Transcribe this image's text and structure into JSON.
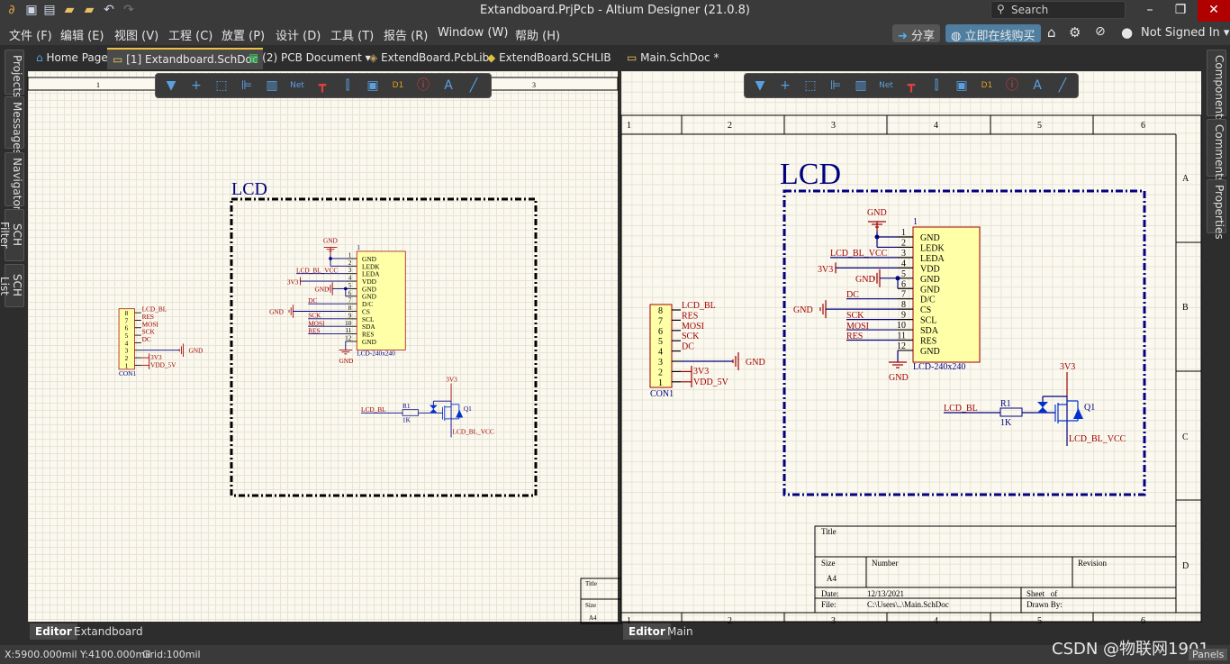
{
  "window": {
    "title": "Extandboard.PrjPcb - Altium Designer (21.0.8)",
    "search_placeholder": "Search",
    "min": "–",
    "restore": "❐",
    "close": "✕"
  },
  "menu": [
    "文件 (F)",
    "编辑 (E)",
    "视图 (V)",
    "工程 (C)",
    "放置 (P)",
    "设计 (D)",
    "工具 (T)",
    "报告 (R)",
    "Window (W)",
    "帮助 (H)"
  ],
  "right_menu": {
    "share": "分享",
    "buy": "立即在线购买",
    "user": "Not Signed In"
  },
  "tabs": [
    {
      "label": "Home Page"
    },
    {
      "label": "[1] Extandboard.SchDoc",
      "active": true
    },
    {
      "label": "(2) PCB Document"
    },
    {
      "label": "ExtendBoard.PcbLib"
    },
    {
      "label": "ExtendBoard.SCHLIB"
    },
    {
      "label": "Main.SchDoc *"
    }
  ],
  "left_panels": [
    "Projects",
    "Messages",
    "Navigator",
    "SCH Filter",
    "SCH List"
  ],
  "right_panels": [
    "Components",
    "Comments",
    "Properties"
  ],
  "toolbar_icons": [
    "filter-icon",
    "crosshair-icon",
    "select-rect-icon",
    "align-icon",
    "part-icon",
    "net-label-icon",
    "power-port-icon",
    "bus-icon",
    "sheet-symbol-icon",
    "port-icon",
    "directive-icon",
    "text-icon",
    "line-icon"
  ],
  "toolbar_text": {
    "net": "Net",
    "vcc": "Vcc",
    "d1": "D1"
  },
  "left_doc": {
    "ruler": [
      "1",
      "3"
    ],
    "title_block": {
      "title": "Title",
      "size": "Size",
      "size_val": "A4"
    },
    "bottom_tabs": [
      "Editor",
      "Extandboard"
    ]
  },
  "right_doc": {
    "columns": [
      "1",
      "2",
      "3",
      "4",
      "5",
      "6"
    ],
    "rows": [
      "A",
      "B",
      "C",
      "D"
    ],
    "title_block": {
      "title": "Title",
      "size": "Size",
      "size_val": "A4",
      "number": "Number",
      "revision": "Revision",
      "date_label": "Date:",
      "date": "12/13/2021",
      "sheet": "Sheet   of",
      "file_label": "File:",
      "file": "C:\\Users\\..\\Main.SchDoc",
      "drawn": "Drawn By:"
    },
    "bottom_tabs": [
      "Editor",
      "Main"
    ]
  },
  "schematic": {
    "room": "LCD",
    "lcd": {
      "designator": "1",
      "comment": "LCD-240x240",
      "pins": [
        "GND",
        "LEDK",
        "LEDA",
        "VDD",
        "GND",
        "GND",
        "D/C",
        "CS",
        "SCL",
        "SDA",
        "RES",
        "GND"
      ]
    },
    "nets": {
      "gnd": "GND",
      "bl_vcc": "LCD_BL_VCC",
      "v33": "3V3",
      "dc": "DC",
      "sck": "SCK",
      "mosi": "MOSI",
      "res": "RES",
      "bl": "LCD_BL",
      "vdd5": "VDD_5V"
    },
    "connector": {
      "designator": "CON1",
      "pins": [
        "8",
        "7",
        "6",
        "5",
        "4",
        "3",
        "2",
        "1"
      ]
    },
    "resistor": {
      "designator": "R1",
      "value": "1K"
    },
    "mosfet": {
      "designator": "Q1"
    },
    "colors": {
      "wire": "#000080",
      "net": "#a00000",
      "part_fill": "#ffffa8",
      "part_border": "#a00000",
      "room": "#000080"
    }
  },
  "status": {
    "coords": "X:5900.000mil Y:4100.000mil",
    "grid": "Grid:100mil",
    "panels": "Panels",
    "watermark": "CSDN @物联网1901"
  }
}
